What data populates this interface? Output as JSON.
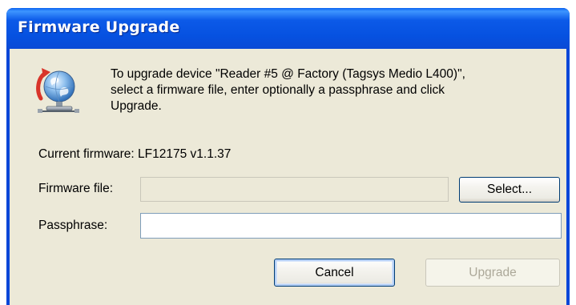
{
  "window": {
    "title": "Firmware Upgrade"
  },
  "icon": {
    "name": "firmware-upgrade-globe-icon"
  },
  "message": {
    "line1": "To upgrade device \"Reader #5 @ Factory (Tagsys Medio L400)\",",
    "line2": "select a firmware file, enter optionally a passphrase and click",
    "line3": "Upgrade."
  },
  "current_firmware": "Current firmware: LF12175 v1.1.37",
  "form": {
    "firmware_file_label": "Firmware file:",
    "firmware_file_value": "",
    "passphrase_label": "Passphrase:",
    "passphrase_value": ""
  },
  "buttons": {
    "select": "Select...",
    "cancel": "Cancel",
    "upgrade": "Upgrade"
  },
  "colors": {
    "titlebar": "#0651e0",
    "client_bg": "#ece9d8",
    "disabled_text": "#aca899"
  }
}
